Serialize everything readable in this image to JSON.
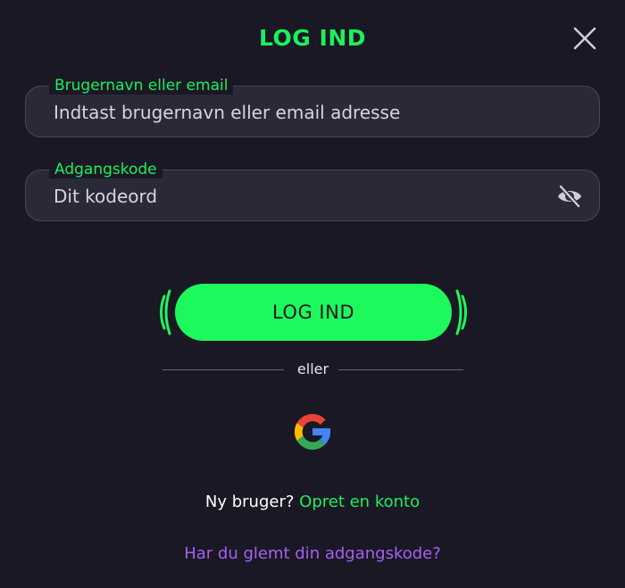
{
  "modal": {
    "title": "LOG IND"
  },
  "fields": {
    "username": {
      "label": "Brugernavn eller email",
      "placeholder": "Indtast brugernavn eller email adresse",
      "value": ""
    },
    "password": {
      "label": "Adgangskode",
      "placeholder": "Dit kodeord",
      "value": "",
      "toggle_icon": "eye-off-icon"
    }
  },
  "login_button": {
    "label": "LOG IND"
  },
  "divider": {
    "text": "eller"
  },
  "google": {
    "icon": "google-icon"
  },
  "signup": {
    "prompt": "Ny bruger?",
    "link": "Opret en konto"
  },
  "forgot": {
    "link": "Har du glemt din adgangskode?"
  },
  "colors": {
    "background": "#1a1824",
    "accent_green": "#1cf05c",
    "button_green": "#1df85d",
    "field_bg": "#2a2937",
    "link_purple": "#a660f2"
  }
}
